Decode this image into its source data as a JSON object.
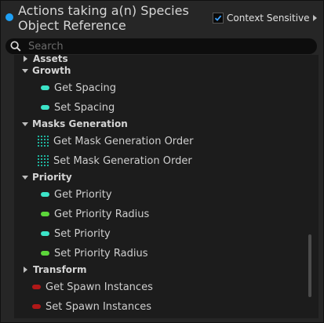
{
  "header": {
    "title": "Actions taking a(n) Species Object Reference",
    "context_sensitive_label": "Context Sensitive",
    "context_sensitive_checked": true
  },
  "search": {
    "placeholder": "Search",
    "value": ""
  },
  "colors": {
    "title_dot": "#1ea0f5",
    "cyan_pin": "#3ce3c8",
    "green_pin": "#5cd63a",
    "red_pin": "#b01818",
    "grid_icon": "#1fb6a0"
  },
  "tree": {
    "assets": {
      "label": "Assets",
      "expanded": false
    },
    "growth": {
      "label": "Growth",
      "expanded": true,
      "items": [
        {
          "label": "Get Spacing",
          "icon": "cyan-pin"
        },
        {
          "label": "Set Spacing",
          "icon": "cyan-pin"
        }
      ]
    },
    "masks": {
      "label": "Masks Generation",
      "expanded": true,
      "items": [
        {
          "label": "Get Mask Generation Order",
          "icon": "grid-icon"
        },
        {
          "label": "Set Mask Generation Order",
          "icon": "grid-icon"
        }
      ]
    },
    "priority": {
      "label": "Priority",
      "expanded": true,
      "items": [
        {
          "label": "Get Priority",
          "icon": "cyan-pin"
        },
        {
          "label": "Get Priority Radius",
          "icon": "green-pin"
        },
        {
          "label": "Set Priority",
          "icon": "cyan-pin"
        },
        {
          "label": "Set Priority Radius",
          "icon": "green-pin"
        }
      ]
    },
    "transform": {
      "label": "Transform",
      "expanded": false,
      "items": [
        {
          "label": "Get Spawn Instances",
          "icon": "red-pin"
        },
        {
          "label": "Set Spawn Instances",
          "icon": "red-pin"
        }
      ]
    }
  },
  "scroll": {
    "position": 0.85
  }
}
